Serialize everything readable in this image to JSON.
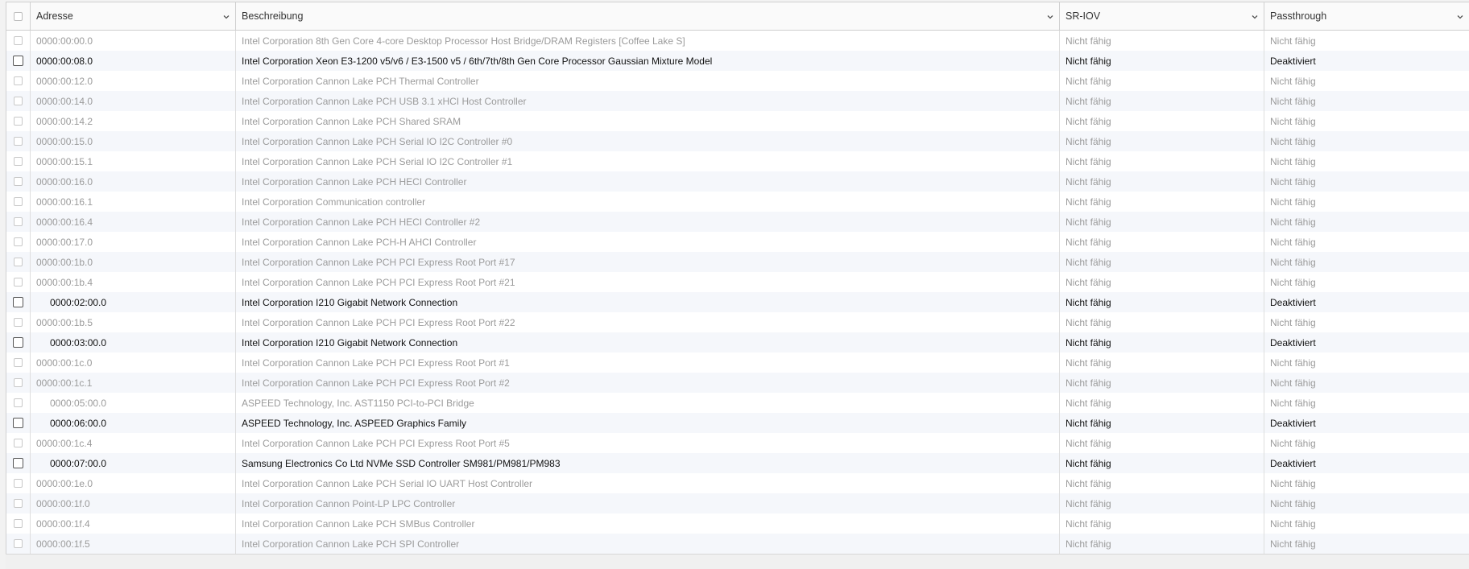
{
  "columns": {
    "address": "Adresse",
    "description": "Beschreibung",
    "sriov": "SR-IOV",
    "passthrough": "Passthrough"
  },
  "rows": [
    {
      "address": "0000:00:00.0",
      "description": "Intel Corporation 8th Gen Core 4-core Desktop Processor Host Bridge/DRAM Registers [Coffee Lake S]",
      "sriov": "Nicht fähig",
      "passthrough": "Nicht fähig"
    },
    {
      "address": "0000:00:08.0",
      "description": "Intel Corporation Xeon E3-1200 v5/v6 / E3-1500 v5 / 6th/7th/8th Gen Core Processor Gaussian Mixture Model",
      "sriov": "Nicht fähig",
      "passthrough": "Deaktiviert"
    },
    {
      "address": "0000:00:12.0",
      "description": "Intel Corporation Cannon Lake PCH Thermal Controller",
      "sriov": "Nicht fähig",
      "passthrough": "Nicht fähig"
    },
    {
      "address": "0000:00:14.0",
      "description": "Intel Corporation Cannon Lake PCH USB 3.1 xHCI Host Controller",
      "sriov": "Nicht fähig",
      "passthrough": "Nicht fähig"
    },
    {
      "address": "0000:00:14.2",
      "description": "Intel Corporation Cannon Lake PCH Shared SRAM",
      "sriov": "Nicht fähig",
      "passthrough": "Nicht fähig"
    },
    {
      "address": "0000:00:15.0",
      "description": "Intel Corporation Cannon Lake PCH Serial IO I2C Controller #0",
      "sriov": "Nicht fähig",
      "passthrough": "Nicht fähig"
    },
    {
      "address": "0000:00:15.1",
      "description": "Intel Corporation Cannon Lake PCH Serial IO I2C Controller #1",
      "sriov": "Nicht fähig",
      "passthrough": "Nicht fähig"
    },
    {
      "address": "0000:00:16.0",
      "description": "Intel Corporation Cannon Lake PCH HECI Controller",
      "sriov": "Nicht fähig",
      "passthrough": "Nicht fähig"
    },
    {
      "address": "0000:00:16.1",
      "description": "Intel Corporation Communication controller",
      "sriov": "Nicht fähig",
      "passthrough": "Nicht fähig"
    },
    {
      "address": "0000:00:16.4",
      "description": "Intel Corporation Cannon Lake PCH HECI Controller #2",
      "sriov": "Nicht fähig",
      "passthrough": "Nicht fähig"
    },
    {
      "address": "0000:00:17.0",
      "description": "Intel Corporation Cannon Lake PCH-H AHCI Controller",
      "sriov": "Nicht fähig",
      "passthrough": "Nicht fähig"
    },
    {
      "address": "0000:00:1b.0",
      "description": "Intel Corporation Cannon Lake PCH PCI Express Root Port #17",
      "sriov": "Nicht fähig",
      "passthrough": "Nicht fähig"
    },
    {
      "address": "0000:00:1b.4",
      "description": "Intel Corporation Cannon Lake PCH PCI Express Root Port #21",
      "sriov": "Nicht fähig",
      "passthrough": "Nicht fähig"
    },
    {
      "address": "0000:02:00.0",
      "description": "Intel Corporation I210 Gigabit Network Connection",
      "sriov": "Nicht fähig",
      "passthrough": "Deaktiviert"
    },
    {
      "address": "0000:00:1b.5",
      "description": "Intel Corporation Cannon Lake PCH PCI Express Root Port #22",
      "sriov": "Nicht fähig",
      "passthrough": "Nicht fähig"
    },
    {
      "address": "0000:03:00.0",
      "description": "Intel Corporation I210 Gigabit Network Connection",
      "sriov": "Nicht fähig",
      "passthrough": "Deaktiviert"
    },
    {
      "address": "0000:00:1c.0",
      "description": "Intel Corporation Cannon Lake PCH PCI Express Root Port #1",
      "sriov": "Nicht fähig",
      "passthrough": "Nicht fähig"
    },
    {
      "address": "0000:00:1c.1",
      "description": "Intel Corporation Cannon Lake PCH PCI Express Root Port #2",
      "sriov": "Nicht fähig",
      "passthrough": "Nicht fähig"
    },
    {
      "address": "0000:05:00.0",
      "description": "ASPEED Technology, Inc. AST1150 PCI-to-PCI Bridge",
      "sriov": "Nicht fähig",
      "passthrough": "Nicht fähig"
    },
    {
      "address": "0000:06:00.0",
      "description": "ASPEED Technology, Inc. ASPEED Graphics Family",
      "sriov": "Nicht fähig",
      "passthrough": "Deaktiviert"
    },
    {
      "address": "0000:00:1c.4",
      "description": "Intel Corporation Cannon Lake PCH PCI Express Root Port #5",
      "sriov": "Nicht fähig",
      "passthrough": "Nicht fähig"
    },
    {
      "address": "0000:07:00.0",
      "description": "Samsung Electronics Co Ltd NVMe SSD Controller SM981/PM981/PM983",
      "sriov": "Nicht fähig",
      "passthrough": "Deaktiviert"
    },
    {
      "address": "0000:00:1e.0",
      "description": "Intel Corporation Cannon Lake PCH Serial IO UART Host Controller",
      "sriov": "Nicht fähig",
      "passthrough": "Nicht fähig"
    },
    {
      "address": "0000:00:1f.0",
      "description": "Intel Corporation Cannon Point-LP LPC Controller",
      "sriov": "Nicht fähig",
      "passthrough": "Nicht fähig"
    },
    {
      "address": "0000:00:1f.4",
      "description": "Intel Corporation Cannon Lake PCH SMBus Controller",
      "sriov": "Nicht fähig",
      "passthrough": "Nicht fähig"
    },
    {
      "address": "0000:00:1f.5",
      "description": "Intel Corporation Cannon Lake PCH SPI Controller",
      "sriov": "Nicht fähig",
      "passthrough": "Nicht fähig"
    }
  ]
}
